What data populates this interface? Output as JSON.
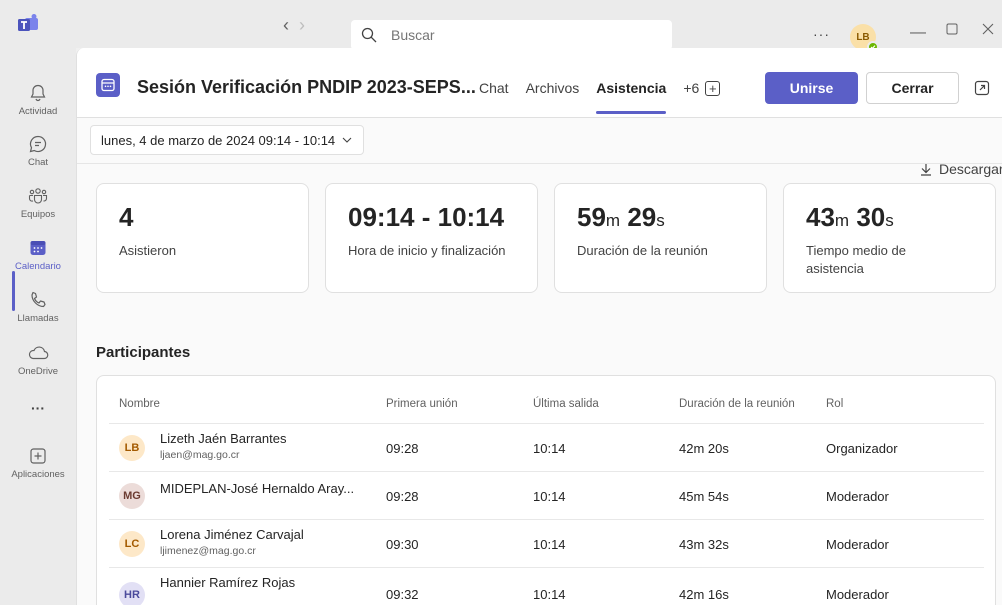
{
  "titlebar": {
    "search_placeholder": "Buscar",
    "more": "···",
    "user_initials": "LB"
  },
  "rail": {
    "items": [
      {
        "label": "Actividad",
        "icon": "bell-icon"
      },
      {
        "label": "Chat",
        "icon": "chat-icon"
      },
      {
        "label": "Equipos",
        "icon": "teams-icon"
      },
      {
        "label": "Calendario",
        "icon": "calendar-icon",
        "active": true
      },
      {
        "label": "Llamadas",
        "icon": "phone-icon"
      },
      {
        "label": "OneDrive",
        "icon": "cloud-icon"
      },
      {
        "label": "···",
        "icon": "more-icon"
      },
      {
        "label": "Aplicaciones",
        "icon": "plus-box-icon"
      }
    ]
  },
  "header": {
    "title": "Sesión Verificación PNDIP 2023-SEPS...",
    "tabs": [
      "Chat",
      "Archivos",
      "Asistencia",
      "+6"
    ],
    "active_tab": "Asistencia",
    "join_label": "Unirse",
    "close_label": "Cerrar"
  },
  "date_range": "lunes, 4 de marzo de 2024 09:14 - 10:14",
  "download_label": "Descargar",
  "stats": [
    {
      "value": "4",
      "label": "Asistieron"
    },
    {
      "value": "09:14 - 10:14",
      "label": "Hora de inicio y finalización"
    },
    {
      "value_main": "59",
      "unit1": "m",
      "value_sec": "29",
      "unit2": "s",
      "label": "Duración de la reunión"
    },
    {
      "value_main": "43",
      "unit1": "m",
      "value_sec": "30",
      "unit2": "s",
      "label": "Tiempo medio de asistencia"
    }
  ],
  "participants_title": "Participantes",
  "table": {
    "headers": [
      "Nombre",
      "Primera unión",
      "Última salida",
      "Duración de la reunión",
      "Rol"
    ],
    "rows": [
      {
        "initials": "LB",
        "name": "Lizeth Jaén Barrantes",
        "email": "ljaen@mag.go.cr",
        "first_join": "09:28",
        "last_leave": "10:14",
        "duration": "42m 20s",
        "role": "Organizador",
        "avatar_bg": "#fde8c8",
        "avatar_fg": "#a35a00"
      },
      {
        "initials": "MG",
        "name": "MIDEPLAN-José Hernaldo Aray...",
        "email": "",
        "first_join": "09:28",
        "last_leave": "10:14",
        "duration": "45m 54s",
        "role": "Moderador",
        "avatar_bg": "#ecdcd9",
        "avatar_fg": "#6b3a30"
      },
      {
        "initials": "LC",
        "name": "Lorena Jiménez Carvajal",
        "email": "ljimenez@mag.go.cr",
        "first_join": "09:30",
        "last_leave": "10:14",
        "duration": "43m 32s",
        "role": "Moderador",
        "avatar_bg": "#fde8c8",
        "avatar_fg": "#a35a00"
      },
      {
        "initials": "HR",
        "name": "Hannier Ramírez Rojas",
        "email": "",
        "first_join": "09:32",
        "last_leave": "10:14",
        "duration": "42m 16s",
        "role": "Moderador",
        "avatar_bg": "#e2e0f5",
        "avatar_fg": "#4b4a9c"
      }
    ]
  },
  "colors": {
    "accent": "#5b5fc7",
    "presence": "#6bb700"
  }
}
